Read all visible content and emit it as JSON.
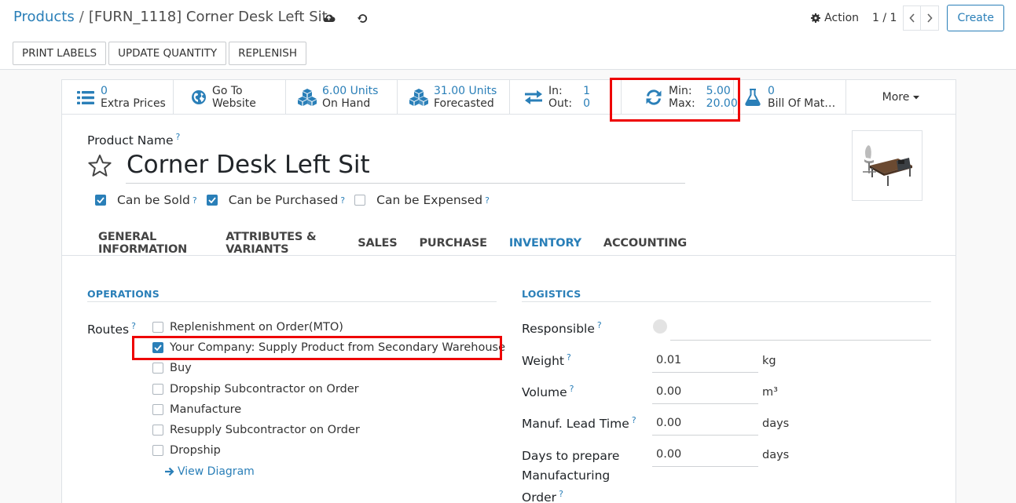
{
  "breadcrumb": {
    "parent": "Products",
    "separator": "/",
    "current": "[FURN_1118] Corner Desk Left Sit"
  },
  "control_panel": {
    "action_label": "Action",
    "pager": "1 / 1",
    "create_label": "Create"
  },
  "header_buttons": {
    "print_labels": "PRINT LABELS",
    "update_quantity": "UPDATE QUANTITY",
    "replenish": "REPLENISH"
  },
  "stat_buttons": {
    "extra_prices": {
      "value": "0",
      "label": "Extra Prices",
      "icon": "list-icon"
    },
    "website": {
      "line1": "Go To",
      "line2": "Website",
      "icon": "globe-icon"
    },
    "on_hand": {
      "value": "6.00 Units",
      "label": "On Hand",
      "icon": "cubes-icon"
    },
    "forecasted": {
      "value": "31.00 Units",
      "label": "Forecasted",
      "icon": "cubes-icon"
    },
    "in_out": {
      "in_label": "In:",
      "in_value": "1",
      "out_label": "Out:",
      "out_value": "0",
      "icon": "exchange-icon"
    },
    "min_max": {
      "min_label": "Min:",
      "min_value": "5.00",
      "max_label": "Max:",
      "max_value": "20.00",
      "icon": "refresh-icon"
    },
    "bom": {
      "value": "0",
      "label": "Bill Of Mat…",
      "icon": "flask-icon"
    },
    "more": "More"
  },
  "product": {
    "name_label": "Product Name",
    "help": "?",
    "name": "Corner Desk Left Sit",
    "can_be_sold": {
      "label": "Can be Sold",
      "checked": true
    },
    "can_be_purchased": {
      "label": "Can be Purchased",
      "checked": true
    },
    "can_be_expensed": {
      "label": "Can be Expensed",
      "checked": false
    }
  },
  "tabs": [
    {
      "label": "GENERAL INFORMATION",
      "active": false
    },
    {
      "label": "ATTRIBUTES & VARIANTS",
      "active": false
    },
    {
      "label": "SALES",
      "active": false
    },
    {
      "label": "PURCHASE",
      "active": false
    },
    {
      "label": "INVENTORY",
      "active": true
    },
    {
      "label": "ACCOUNTING",
      "active": false
    }
  ],
  "operations": {
    "title": "OPERATIONS",
    "routes_label": "Routes",
    "routes": [
      {
        "label": "Replenishment on Order(MTO)",
        "checked": false
      },
      {
        "label": "Your Company: Supply Product from Secondary Warehouse",
        "checked": true
      },
      {
        "label": "Buy",
        "checked": false
      },
      {
        "label": "Dropship Subcontractor on Order",
        "checked": false
      },
      {
        "label": "Manufacture",
        "checked": false
      },
      {
        "label": "Resupply Subcontractor on Order",
        "checked": false
      },
      {
        "label": "Dropship",
        "checked": false
      }
    ],
    "view_diagram": "View Diagram"
  },
  "logistics": {
    "title": "LOGISTICS",
    "responsible_label": "Responsible",
    "weight": {
      "label": "Weight",
      "value": "0.01",
      "unit": "kg"
    },
    "volume": {
      "label": "Volume",
      "value": "0.00",
      "unit": "m³"
    },
    "lead_time": {
      "label": "Manuf. Lead Time",
      "value": "0.00",
      "unit": "days"
    },
    "days_prepare": {
      "label_line1": "Days to prepare",
      "label_line2": "Manufacturing",
      "label_line3": "Order",
      "value": "0.00",
      "unit": "days"
    }
  },
  "colors": {
    "accent": "#2a7fb8",
    "highlight": "#e00000"
  }
}
